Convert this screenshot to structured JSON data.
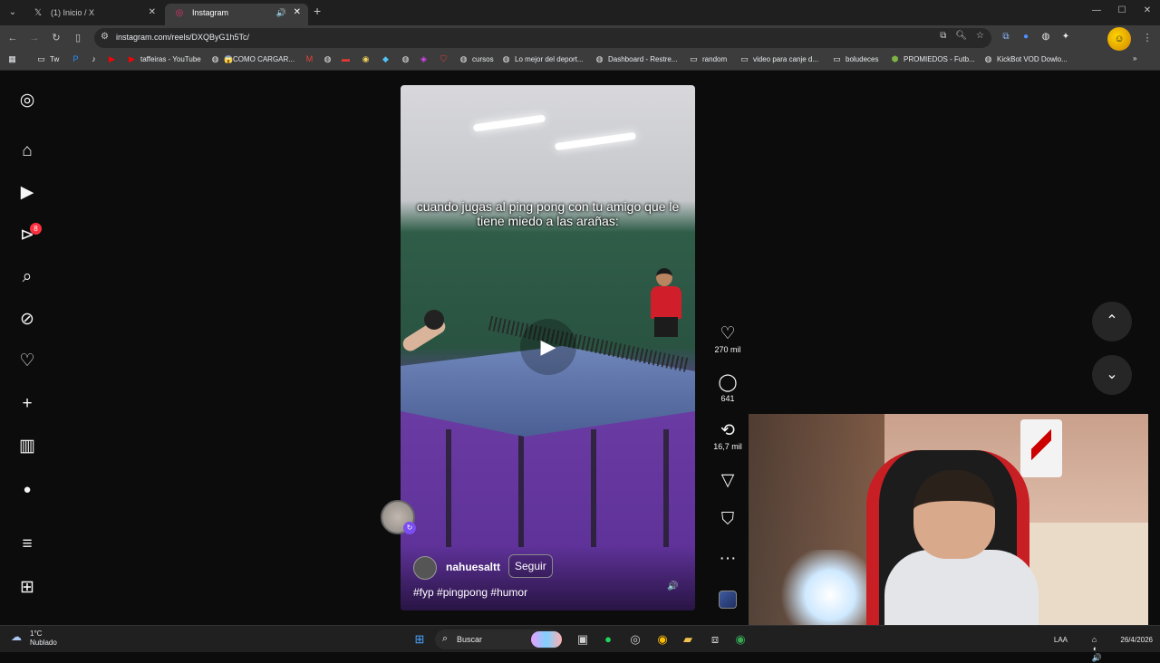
{
  "browser": {
    "tabs": [
      {
        "title": "(1) Inicio / X",
        "icon": "x-logo-icon"
      },
      {
        "title": "Instagram",
        "icon": "instagram-icon",
        "active": true
      }
    ],
    "url": "instagram.com/reels/DXQByG1h5Tc/",
    "bookmarks": [
      {
        "label": "Tw",
        "icon": "folder-icon"
      },
      {
        "label": "",
        "icon": "paypal-icon"
      },
      {
        "label": "",
        "icon": "tiktok-icon"
      },
      {
        "label": "",
        "icon": "youtube-icon"
      },
      {
        "label": "taffeiras - YouTube",
        "icon": "youtube-icon"
      },
      {
        "label": "😱COMO CARGAR...",
        "icon": "globe-icon"
      },
      {
        "label": "",
        "icon": "gmail-icon"
      },
      {
        "label": "",
        "icon": "globe-icon"
      },
      {
        "label": "",
        "icon": "app-icon"
      },
      {
        "label": "",
        "icon": "app-icon"
      },
      {
        "label": "",
        "icon": "app-icon"
      },
      {
        "label": "",
        "icon": "globe-icon"
      },
      {
        "label": "",
        "icon": "app-icon"
      },
      {
        "label": "cursos",
        "icon": "globe-icon"
      },
      {
        "label": "Lo mejor del deport...",
        "icon": "globe-icon"
      },
      {
        "label": "Dashboard - Restre...",
        "icon": "globe-icon"
      },
      {
        "label": "random",
        "icon": "folder-icon"
      },
      {
        "label": "video para canje d...",
        "icon": "folder-icon"
      },
      {
        "label": "boludeces",
        "icon": "folder-icon"
      },
      {
        "label": "PROMIEDOS - Futb...",
        "icon": "app-icon"
      },
      {
        "label": "KickBot VOD Dowlo...",
        "icon": "globe-icon"
      }
    ]
  },
  "sidebar": {
    "notification_count": "8"
  },
  "reel": {
    "caption": "cuando jugas al ping pong con tu amigo que le tiene miedo a las arañas:",
    "author": "nahuesaltt",
    "follow_label": "Seguir",
    "hashtags": "#fyp #pingpong #humor",
    "likes": "270 mil",
    "comments": "641",
    "reposts": "16,7 mil"
  },
  "taskbar": {
    "temperature": "1°C",
    "weather": "Nublado",
    "search_label": "Buscar",
    "language": "LAA",
    "date": "26/4/2026"
  }
}
